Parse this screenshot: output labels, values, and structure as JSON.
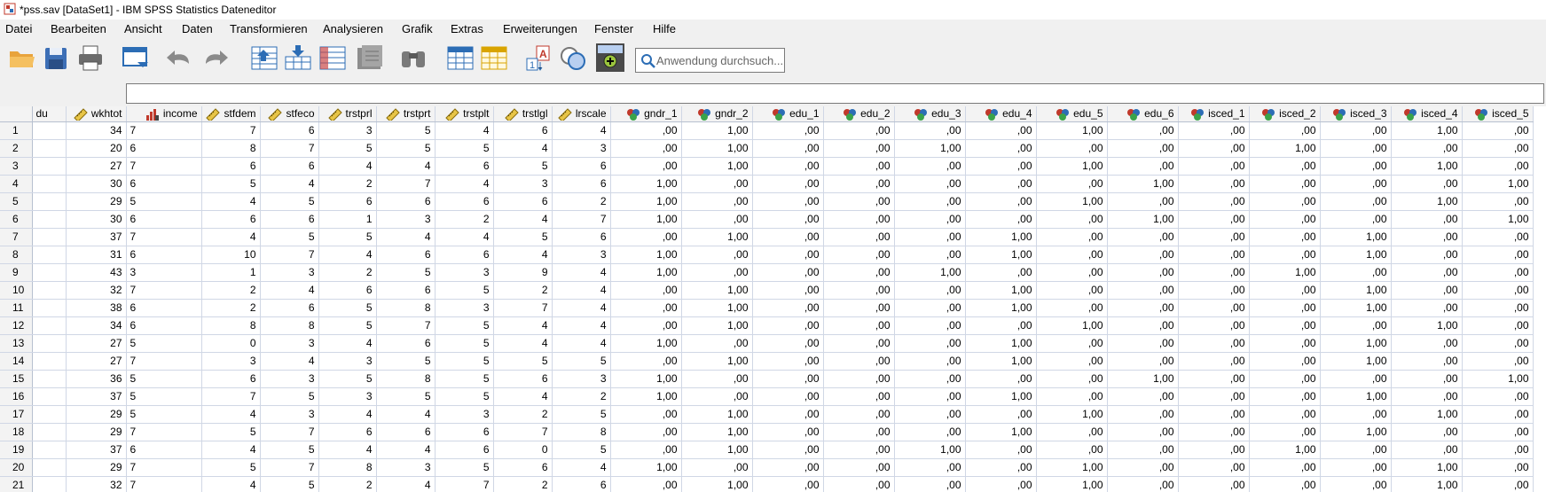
{
  "window": {
    "title": "*pss.sav [DataSet1] - IBM SPSS Statistics Dateneditor"
  },
  "menu": [
    "Datei",
    "Bearbeiten",
    "Ansicht",
    "Daten",
    "Transformieren",
    "Analysieren",
    "Grafik",
    "Extras",
    "Erweiterungen",
    "Fenster",
    "Hilfe"
  ],
  "toolbar": {
    "search_placeholder": "Anwendung durchsuch...",
    "buttons": [
      "open-folder-icon",
      "save-icon",
      "print-icon",
      "recall-dialog-icon",
      "undo-icon",
      "redo-icon",
      "goto-case-icon",
      "goto-variable-icon",
      "variables-icon",
      "run-descriptives-icon",
      "find-icon",
      "insert-cases-icon",
      "insert-variable-icon",
      "split-file-icon",
      "weight-cases-icon",
      "select-cases-icon",
      "value-labels-icon",
      "use-sets-icon"
    ]
  },
  "columns": [
    {
      "name": "du",
      "icon": "none"
    },
    {
      "name": "wkhtot",
      "icon": "scale-ruler-icon"
    },
    {
      "name": "income",
      "icon": "ordinal-bars-icon"
    },
    {
      "name": "stfdem",
      "icon": "scale-ruler-icon"
    },
    {
      "name": "stfeco",
      "icon": "scale-ruler-icon"
    },
    {
      "name": "trstprl",
      "icon": "scale-ruler-icon"
    },
    {
      "name": "trstprt",
      "icon": "scale-ruler-icon"
    },
    {
      "name": "trstplt",
      "icon": "scale-ruler-icon"
    },
    {
      "name": "trstlgl",
      "icon": "scale-ruler-icon"
    },
    {
      "name": "lrscale",
      "icon": "scale-ruler-icon"
    },
    {
      "name": "gndr_1",
      "icon": "nominal-circles-icon"
    },
    {
      "name": "gndr_2",
      "icon": "nominal-circles-icon"
    },
    {
      "name": "edu_1",
      "icon": "nominal-circles-icon"
    },
    {
      "name": "edu_2",
      "icon": "nominal-circles-icon"
    },
    {
      "name": "edu_3",
      "icon": "nominal-circles-icon"
    },
    {
      "name": "edu_4",
      "icon": "nominal-circles-icon"
    },
    {
      "name": "edu_5",
      "icon": "nominal-circles-icon"
    },
    {
      "name": "edu_6",
      "icon": "nominal-circles-icon"
    },
    {
      "name": "isced_1",
      "icon": "nominal-circles-icon"
    },
    {
      "name": "isced_2",
      "icon": "nominal-circles-icon"
    },
    {
      "name": "isced_3",
      "icon": "nominal-circles-icon"
    },
    {
      "name": "isced_4",
      "icon": "nominal-circles-icon"
    },
    {
      "name": "isced_5",
      "icon": "nominal-circles-icon"
    }
  ],
  "rows": [
    [
      "1",
      "",
      "34",
      "7",
      "7",
      "6",
      "3",
      "5",
      "4",
      "6",
      "4",
      ",00",
      "1,00",
      ",00",
      ",00",
      ",00",
      ",00",
      "1,00",
      ",00",
      ",00",
      ",00",
      ",00",
      "1,00",
      ",00"
    ],
    [
      "2",
      "",
      "20",
      "6",
      "8",
      "7",
      "5",
      "5",
      "5",
      "4",
      "3",
      ",00",
      "1,00",
      ",00",
      ",00",
      "1,00",
      ",00",
      ",00",
      ",00",
      ",00",
      "1,00",
      ",00",
      ",00",
      ",00"
    ],
    [
      "3",
      "",
      "27",
      "7",
      "6",
      "6",
      "4",
      "4",
      "6",
      "5",
      "6",
      ",00",
      "1,00",
      ",00",
      ",00",
      ",00",
      ",00",
      "1,00",
      ",00",
      ",00",
      ",00",
      ",00",
      "1,00",
      ",00"
    ],
    [
      "4",
      "",
      "30",
      "6",
      "5",
      "4",
      "2",
      "7",
      "4",
      "3",
      "6",
      "1,00",
      ",00",
      ",00",
      ",00",
      ",00",
      ",00",
      ",00",
      "1,00",
      ",00",
      ",00",
      ",00",
      ",00",
      "1,00"
    ],
    [
      "5",
      "",
      "29",
      "5",
      "4",
      "5",
      "6",
      "6",
      "6",
      "6",
      "2",
      "1,00",
      ",00",
      ",00",
      ",00",
      ",00",
      ",00",
      "1,00",
      ",00",
      ",00",
      ",00",
      ",00",
      "1,00",
      ",00"
    ],
    [
      "6",
      "",
      "30",
      "6",
      "6",
      "6",
      "1",
      "3",
      "2",
      "4",
      "7",
      "1,00",
      ",00",
      ",00",
      ",00",
      ",00",
      ",00",
      ",00",
      "1,00",
      ",00",
      ",00",
      ",00",
      ",00",
      "1,00"
    ],
    [
      "7",
      "",
      "37",
      "7",
      "4",
      "5",
      "5",
      "4",
      "4",
      "5",
      "6",
      ",00",
      "1,00",
      ",00",
      ",00",
      ",00",
      "1,00",
      ",00",
      ",00",
      ",00",
      ",00",
      "1,00",
      ",00",
      ",00"
    ],
    [
      "8",
      "",
      "31",
      "6",
      "10",
      "7",
      "4",
      "6",
      "6",
      "4",
      "3",
      "1,00",
      ",00",
      ",00",
      ",00",
      ",00",
      "1,00",
      ",00",
      ",00",
      ",00",
      ",00",
      "1,00",
      ",00",
      ",00"
    ],
    [
      "9",
      "",
      "43",
      "3",
      "1",
      "3",
      "2",
      "5",
      "3",
      "9",
      "4",
      "1,00",
      ",00",
      ",00",
      ",00",
      "1,00",
      ",00",
      ",00",
      ",00",
      ",00",
      "1,00",
      ",00",
      ",00",
      ",00"
    ],
    [
      "10",
      "",
      "32",
      "7",
      "2",
      "4",
      "6",
      "6",
      "5",
      "2",
      "4",
      ",00",
      "1,00",
      ",00",
      ",00",
      ",00",
      "1,00",
      ",00",
      ",00",
      ",00",
      ",00",
      "1,00",
      ",00",
      ",00"
    ],
    [
      "11",
      "",
      "38",
      "6",
      "2",
      "6",
      "5",
      "8",
      "3",
      "7",
      "4",
      ",00",
      "1,00",
      ",00",
      ",00",
      ",00",
      "1,00",
      ",00",
      ",00",
      ",00",
      ",00",
      "1,00",
      ",00",
      ",00"
    ],
    [
      "12",
      "",
      "34",
      "6",
      "8",
      "8",
      "5",
      "7",
      "5",
      "4",
      "4",
      ",00",
      "1,00",
      ",00",
      ",00",
      ",00",
      ",00",
      "1,00",
      ",00",
      ",00",
      ",00",
      ",00",
      "1,00",
      ",00"
    ],
    [
      "13",
      "",
      "27",
      "5",
      "0",
      "3",
      "4",
      "6",
      "5",
      "4",
      "4",
      "1,00",
      ",00",
      ",00",
      ",00",
      ",00",
      "1,00",
      ",00",
      ",00",
      ",00",
      ",00",
      "1,00",
      ",00",
      ",00"
    ],
    [
      "14",
      "",
      "27",
      "7",
      "3",
      "4",
      "3",
      "5",
      "5",
      "5",
      "5",
      ",00",
      "1,00",
      ",00",
      ",00",
      ",00",
      "1,00",
      ",00",
      ",00",
      ",00",
      ",00",
      "1,00",
      ",00",
      ",00"
    ],
    [
      "15",
      "",
      "36",
      "5",
      "6",
      "3",
      "5",
      "8",
      "5",
      "6",
      "3",
      "1,00",
      ",00",
      ",00",
      ",00",
      ",00",
      ",00",
      ",00",
      "1,00",
      ",00",
      ",00",
      ",00",
      ",00",
      "1,00"
    ],
    [
      "16",
      "",
      "37",
      "5",
      "7",
      "5",
      "3",
      "5",
      "5",
      "4",
      "2",
      "1,00",
      ",00",
      ",00",
      ",00",
      ",00",
      "1,00",
      ",00",
      ",00",
      ",00",
      ",00",
      "1,00",
      ",00",
      ",00"
    ],
    [
      "17",
      "",
      "29",
      "5",
      "4",
      "3",
      "4",
      "4",
      "3",
      "2",
      "5",
      ",00",
      "1,00",
      ",00",
      ",00",
      ",00",
      ",00",
      "1,00",
      ",00",
      ",00",
      ",00",
      ",00",
      "1,00",
      ",00"
    ],
    [
      "18",
      "",
      "29",
      "7",
      "5",
      "7",
      "6",
      "6",
      "6",
      "7",
      "8",
      ",00",
      "1,00",
      ",00",
      ",00",
      ",00",
      "1,00",
      ",00",
      ",00",
      ",00",
      ",00",
      "1,00",
      ",00",
      ",00"
    ],
    [
      "19",
      "",
      "37",
      "6",
      "4",
      "5",
      "4",
      "4",
      "6",
      "0",
      "5",
      ",00",
      "1,00",
      ",00",
      ",00",
      "1,00",
      ",00",
      ",00",
      ",00",
      ",00",
      "1,00",
      ",00",
      ",00",
      ",00"
    ],
    [
      "20",
      "",
      "29",
      "7",
      "5",
      "7",
      "8",
      "3",
      "5",
      "6",
      "4",
      "1,00",
      ",00",
      ",00",
      ",00",
      ",00",
      ",00",
      "1,00",
      ",00",
      ",00",
      ",00",
      ",00",
      "1,00",
      ",00"
    ],
    [
      "21",
      "",
      "32",
      "7",
      "4",
      "5",
      "2",
      "4",
      "7",
      "2",
      "6",
      ",00",
      "1,00",
      ",00",
      ",00",
      ",00",
      ",00",
      "1,00",
      ",00",
      ",00",
      ",00",
      ",00",
      "1,00",
      ",00"
    ]
  ]
}
